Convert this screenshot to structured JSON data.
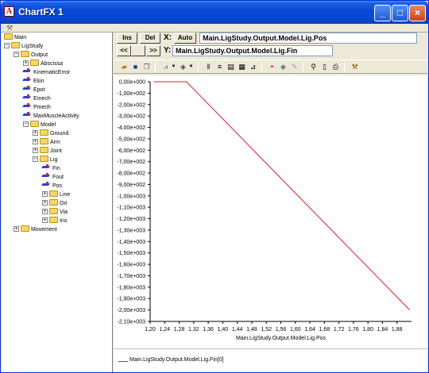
{
  "window": {
    "title": "ChartFX 1"
  },
  "tree": {
    "nodes": [
      {
        "label": "Main",
        "kind": "folder",
        "expander": "",
        "level": 0
      },
      {
        "label": "LigStudy",
        "kind": "folder",
        "expander": "−",
        "level": 0
      },
      {
        "label": "Output",
        "kind": "folder",
        "expander": "−",
        "level": 1
      },
      {
        "label": "Abscissa",
        "kind": "folder",
        "expander": "+",
        "level": 2
      },
      {
        "label": "KinematicError",
        "kind": "signal",
        "expander": "",
        "level": 2
      },
      {
        "label": "Ekin",
        "kind": "signal",
        "expander": "",
        "level": 2
      },
      {
        "label": "Epot",
        "kind": "signal",
        "expander": "",
        "level": 2
      },
      {
        "label": "Emech",
        "kind": "signal",
        "expander": "",
        "level": 2
      },
      {
        "label": "Pmech",
        "kind": "signal",
        "expander": "",
        "level": 2
      },
      {
        "label": "MaxMuscleActivity",
        "kind": "signal",
        "expander": "",
        "level": 2
      },
      {
        "label": "Model",
        "kind": "folder",
        "expander": "−",
        "level": 2
      },
      {
        "label": "Ground",
        "kind": "folder",
        "expander": "+",
        "level": 3
      },
      {
        "label": "Arm",
        "kind": "folder",
        "expander": "+",
        "level": 3
      },
      {
        "label": "Joint",
        "kind": "folder",
        "expander": "+",
        "level": 3
      },
      {
        "label": "Lig",
        "kind": "folder",
        "expander": "−",
        "level": 3
      },
      {
        "label": "Fin",
        "kind": "signal",
        "expander": "",
        "level": 4
      },
      {
        "label": "Fout",
        "kind": "signal",
        "expander": "",
        "level": 4
      },
      {
        "label": "Pos",
        "kind": "signal",
        "expander": "",
        "level": 4
      },
      {
        "label": "Line",
        "kind": "folder",
        "expander": "+",
        "level": 4
      },
      {
        "label": "Ori",
        "kind": "folder",
        "expander": "+",
        "level": 4
      },
      {
        "label": "Via",
        "kind": "folder",
        "expander": "+",
        "level": 4
      },
      {
        "label": "Ins",
        "kind": "folder",
        "expander": "+",
        "level": 4
      },
      {
        "label": "Movement",
        "kind": "folder",
        "expander": "+",
        "level": 1
      }
    ]
  },
  "controls": {
    "ins_label": "Ins",
    "del_label": "Del",
    "x_axis_label": "X:",
    "auto_label": "Auto",
    "x_field": "Main.LigStudy.Output.Model.Lig.Pos",
    "prev_label": "<<",
    "next_label": ">>",
    "y_axis_label": "Y:",
    "y_field": "Main.LigStudy.Output.Model.Lig.Fin"
  },
  "toolbar": {
    "icons": [
      "open-icon",
      "save-icon",
      "copy-icon",
      "chart-type-icon",
      "palette-icon",
      "vertical-grid-icon",
      "horizontal-grid-icon",
      "legend-icon",
      "data-grid-icon",
      "axis-icon",
      "rotate-3d-icon",
      "color-icon",
      "tools-icon",
      "zoom-icon",
      "page-setup-icon",
      "print-icon",
      "properties-icon"
    ]
  },
  "chart_data": {
    "type": "line",
    "xlabel": "Main.LigStudy.Output.Model.Lig.Pos",
    "ylabel": "",
    "xlim": [
      1.2,
      1.92
    ],
    "ylim": [
      -2100,
      0
    ],
    "x_ticks": [
      "1,20",
      "1,24",
      "1,28",
      "1,32",
      "1,36",
      "1,40",
      "1,44",
      "1,48",
      "1,52",
      "1,56",
      "1,60",
      "1,64",
      "1,68",
      "1,72",
      "1,76",
      "1,80",
      "1,84",
      "1,88"
    ],
    "y_ticks": [
      "0,00e+000",
      "-1,00e+002",
      "-2,00e+002",
      "-3,00e+002",
      "-4,00e+002",
      "-5,00e+002",
      "-6,00e+002",
      "-7,00e+002",
      "-8,00e+002",
      "-9,00e+002",
      "-1,00e+003",
      "-1,10e+003",
      "-1,20e+003",
      "-1,30e+003",
      "-1,40e+003",
      "-1,50e+003",
      "-1,60e+003",
      "-1,70e+003",
      "-1,80e+003",
      "-1,90e+003",
      "-2,00e+003",
      "-2,10e+003"
    ],
    "series": [
      {
        "name": "Main.LigStudy.Output.Model.Lig.Fin[0]",
        "color": "#e02020",
        "x": [
          1.21,
          1.3,
          1.915
        ],
        "y": [
          0,
          0,
          -2000
        ]
      }
    ],
    "legend": "bottom",
    "grid": false
  }
}
